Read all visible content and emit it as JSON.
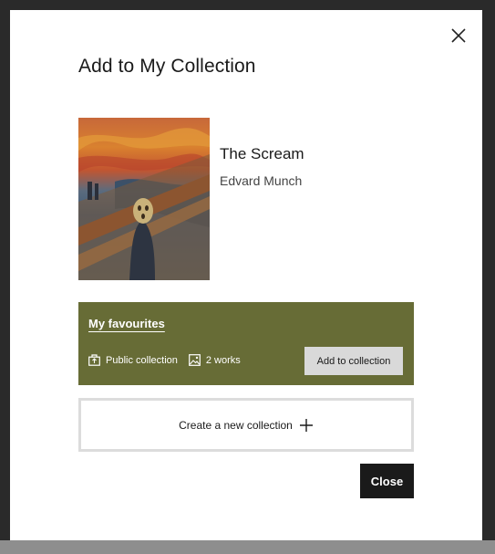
{
  "modal": {
    "title": "Add to My Collection",
    "close_icon": "close-icon"
  },
  "artwork": {
    "title": "The Scream",
    "artist": "Edvard Munch"
  },
  "collection": {
    "name": "My favourites",
    "visibility": "Public collection",
    "visibility_icon": "public-collection-icon",
    "works": "2 works",
    "works_icon": "image-icon",
    "add_label": "Add to collection",
    "accent_color": "#676c36"
  },
  "create": {
    "label": "Create a new collection",
    "icon": "plus-icon"
  },
  "footer": {
    "close_label": "Close"
  }
}
